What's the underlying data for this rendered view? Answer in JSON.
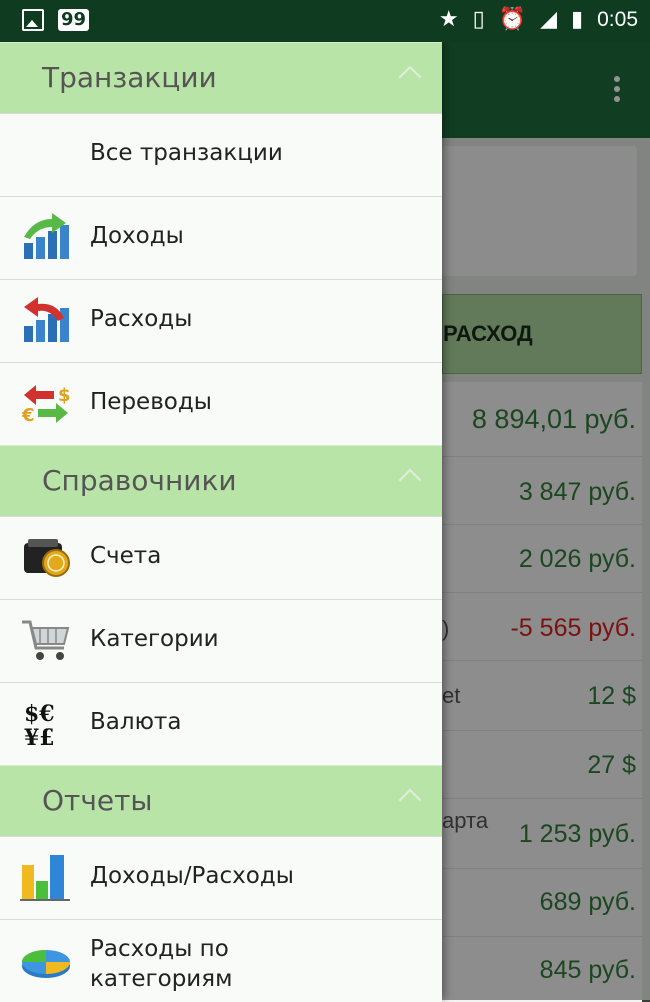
{
  "status_bar": {
    "badge": "99",
    "time": "0:05"
  },
  "background_app": {
    "button_label": "РАСХОД",
    "rows": [
      {
        "left": "",
        "value": "8 894,01 руб.",
        "kind": "total"
      },
      {
        "left": "",
        "value": "3 847 руб.",
        "kind": "pos"
      },
      {
        "left": "",
        "value": "2 026 руб.",
        "kind": "pos"
      },
      {
        "left": ")",
        "value": "-5 565 руб.",
        "kind": "neg"
      },
      {
        "left": "et",
        "value": "12 $",
        "kind": "pos"
      },
      {
        "left": "",
        "value": "27 $",
        "kind": "pos"
      },
      {
        "left": "арта",
        "value": "1 253 руб.",
        "kind": "pos"
      },
      {
        "left": "",
        "value": "689 руб.",
        "kind": "pos"
      },
      {
        "left": "",
        "value": "845 руб.",
        "kind": "pos"
      }
    ]
  },
  "drawer": {
    "sections": [
      {
        "title": "Транзакции",
        "items": [
          {
            "label": "Все транзакции",
            "icon": "none"
          },
          {
            "label": "Доходы",
            "icon": "income-chart-icon"
          },
          {
            "label": "Расходы",
            "icon": "expense-chart-icon"
          },
          {
            "label": "Переводы",
            "icon": "transfer-arrows-icon"
          }
        ]
      },
      {
        "title": "Справочники",
        "items": [
          {
            "label": "Счета",
            "icon": "wallet-icon"
          },
          {
            "label": "Категории",
            "icon": "shopping-cart-icon"
          },
          {
            "label": "Валюта",
            "icon": "currency-symbols-icon"
          }
        ]
      },
      {
        "title": "Отчеты",
        "items": [
          {
            "label": "Доходы/Расходы",
            "icon": "bar-chart-icon"
          },
          {
            "label": "Расходы по категориям",
            "icon": "pie-chart-icon"
          }
        ]
      }
    ]
  },
  "colors": {
    "status_bar": "#0f3b20",
    "app_bar": "#1e6b3c",
    "section_header": "#b9e4a8",
    "positive": "#2f7a38",
    "negative": "#d42020"
  }
}
